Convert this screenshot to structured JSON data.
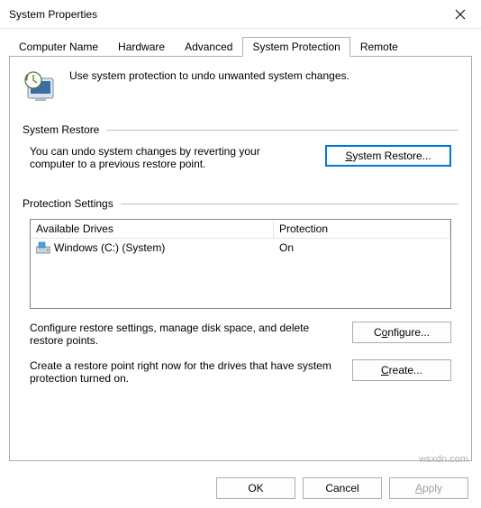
{
  "window": {
    "title": "System Properties"
  },
  "tabs": {
    "items": [
      {
        "label": "Computer Name"
      },
      {
        "label": "Hardware"
      },
      {
        "label": "Advanced"
      },
      {
        "label": "System Protection"
      },
      {
        "label": "Remote"
      }
    ],
    "active_index": 3
  },
  "intro_text": "Use system protection to undo unwanted system changes.",
  "system_restore": {
    "header": "System Restore",
    "desc": "You can undo system changes by reverting your computer to a previous restore point.",
    "button": "System Restore..."
  },
  "protection_settings": {
    "header": "Protection Settings",
    "columns": {
      "drive": "Available Drives",
      "protection": "Protection"
    },
    "rows": [
      {
        "drive": "Windows (C:) (System)",
        "protection": "On"
      }
    ],
    "configure": {
      "desc": "Configure restore settings, manage disk space, and delete restore points.",
      "button": "Configure..."
    },
    "create": {
      "desc": "Create a restore point right now for the drives that have system protection turned on.",
      "button": "Create..."
    }
  },
  "footer": {
    "ok": "OK",
    "cancel": "Cancel",
    "apply": "Apply"
  },
  "watermark": "wsxdn.com"
}
